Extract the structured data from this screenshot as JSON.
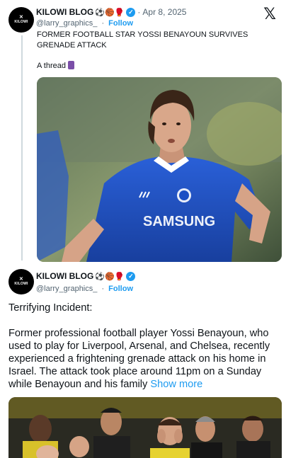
{
  "tweet1": {
    "author_name": "KILOWI BLOG",
    "emojis": "⚽🏀🥊",
    "date": "Apr 8, 2025",
    "handle": "@larry_graphics_",
    "follow_label": "Follow",
    "text": "FORMER FOOTBALL STAR YOSSI BENAYOUN SURVIVES GRENADE ATTACK",
    "thread_label": "A thread"
  },
  "tweet2": {
    "author_name": "KILOWI BLOG",
    "emojis": "⚽🏀🥊",
    "handle": "@larry_graphics_",
    "follow_label": "Follow",
    "heading": "Terrifying Incident:",
    "body": "Former professional football player Yossi Benayoun, who used to play for Liverpool, Arsenal, and Chelsea, recently experienced a frightening grenade attack on his home in Israel. The attack took place around 11pm on a Sunday while Benayoun and his family",
    "show_more": "Show more"
  },
  "avatar_text": "KILOWI",
  "separator": "·",
  "photo1_text": {
    "shirt_sponsor": "SAMSUNG"
  },
  "colors": {
    "link": "#1d9bf0",
    "muted": "#536471",
    "text": "#0f1419",
    "line": "#cfd9de",
    "chelsea_blue": "#1c4fc4"
  }
}
